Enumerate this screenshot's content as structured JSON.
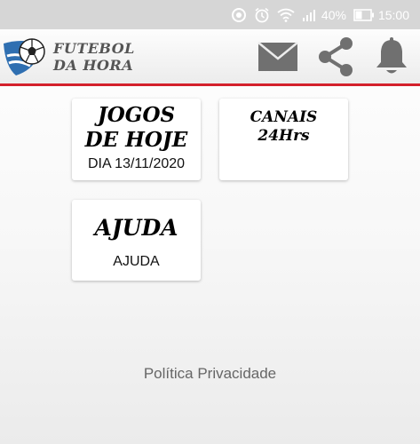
{
  "status_bar": {
    "battery_percent": "40%",
    "time": "15:00",
    "icons": [
      "sync-icon",
      "alarm-icon",
      "wifi-icon",
      "signal-icon",
      "battery-icon"
    ]
  },
  "app_bar": {
    "brand_line1": "FUTEBOL",
    "brand_line2": "DA HORA",
    "accent_color": "#d3212b",
    "actions": [
      "mail-icon",
      "share-icon",
      "bell-icon"
    ]
  },
  "cards": {
    "games": {
      "title_line1": "JOGOS",
      "title_line2": "DE HOJE",
      "subtitle": "DIA 13/11/2020"
    },
    "channels": {
      "title_line1": "CANAIS",
      "title_line2": "24Hrs"
    },
    "help": {
      "title": "AJUDA",
      "subtitle": "AJUDA"
    }
  },
  "footer": {
    "privacy_link": "Política Privacidade"
  }
}
